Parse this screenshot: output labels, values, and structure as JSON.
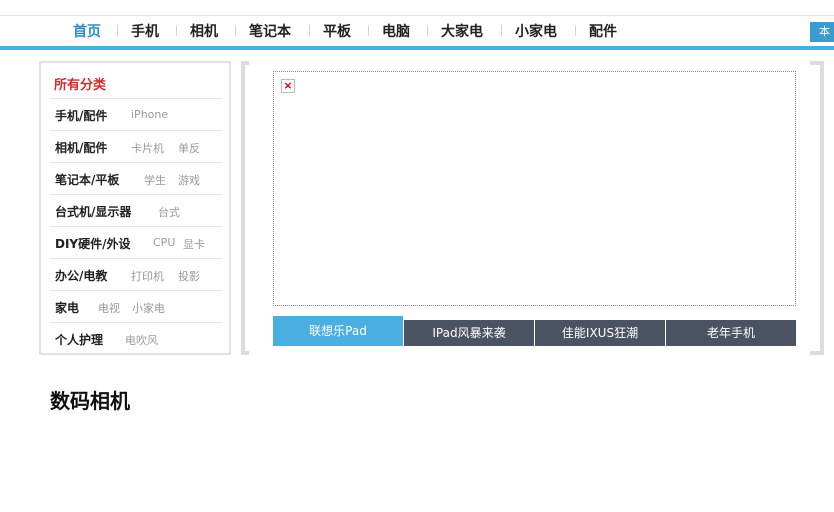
{
  "nav": {
    "items": [
      "首页",
      "手机",
      "相机",
      "笔记本",
      "平板",
      "电脑",
      "大家电",
      "小家电",
      "配件"
    ],
    "active_index": 0,
    "right_button_label": "本"
  },
  "categories": {
    "title": "所有分类",
    "rows": [
      {
        "name": "手机/配件",
        "subs": [
          "iPhone"
        ]
      },
      {
        "name": "相机/配件",
        "subs": [
          "卡片机",
          "单反"
        ]
      },
      {
        "name": "笔记本/平板",
        "subs": [
          "学生",
          "游戏"
        ]
      },
      {
        "name": "台式机/显示器",
        "subs": [
          "台式"
        ]
      },
      {
        "name": "DIY硬件/外设",
        "subs": [
          "CPU",
          "显卡"
        ]
      },
      {
        "name": "办公/电教",
        "subs": [
          "打印机",
          "投影"
        ]
      },
      {
        "name": "家电",
        "subs": [
          "电视",
          "小家电"
        ]
      },
      {
        "name": "个人护理",
        "subs": [
          "电吹风"
        ]
      }
    ]
  },
  "banner": {
    "broken_image_glyph": "×",
    "tabs": [
      "联想乐Pad",
      "IPad风暴来袭",
      "佳能IXUS狂潮",
      "老年手机"
    ],
    "active_tab": 0
  },
  "section": {
    "title": "数码相机"
  },
  "colors": {
    "accent": "#3fb3dd",
    "active_nav": "#2a8fc8",
    "category_title": "#c9302c",
    "tab_dark": "#4b5363",
    "tab_active": "#4aaee0"
  }
}
